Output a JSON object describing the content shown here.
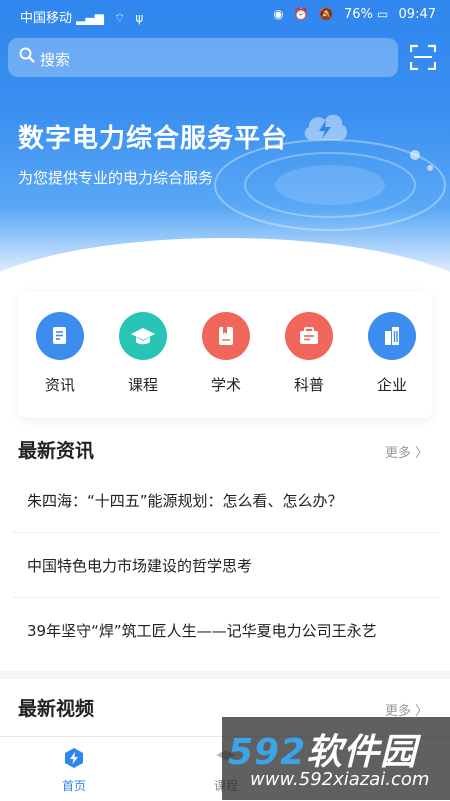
{
  "status_bar": {
    "carrier": "中国移动",
    "battery": "76%",
    "time": "09:47"
  },
  "search": {
    "placeholder": "搜索"
  },
  "banner": {
    "title": "数字电力综合服务平台",
    "subtitle": "为您提供专业的电力综合服务",
    "slide_count": 3,
    "active_slide": 1
  },
  "categories": [
    {
      "label": "资讯",
      "color": "#3d8cf0",
      "icon": "document-icon"
    },
    {
      "label": "课程",
      "color": "#27c5b5",
      "icon": "graduation-cap-icon"
    },
    {
      "label": "学术",
      "color": "#f0665a",
      "icon": "book-icon"
    },
    {
      "label": "科普",
      "color": "#f0665a",
      "icon": "briefcase-icon"
    },
    {
      "label": "企业",
      "color": "#3d8cf0",
      "icon": "building-icon"
    }
  ],
  "latest_news": {
    "title": "最新资讯",
    "more": "更多",
    "items": [
      "朱四海：“十四五”能源规划：怎么看、怎么办？",
      "中国特色电力市场建设的哲学思考",
      "39年坚守“焊”筑工匠人生——记华夏电力公司王永艺"
    ]
  },
  "latest_video": {
    "title": "最新视频",
    "more": "更多"
  },
  "tabbar": {
    "tabs": [
      {
        "label": "首页",
        "icon": "home-icon",
        "active": true
      },
      {
        "label": "课程",
        "icon": "course-icon",
        "active": false
      }
    ]
  },
  "watermark": {
    "brand_num": "592",
    "brand_cn": "软件园",
    "url": "www.592xiazai.com"
  },
  "colors": {
    "accent": "#2f86ee",
    "tab_active": "#2f86ee",
    "tab_inactive": "#888888"
  }
}
